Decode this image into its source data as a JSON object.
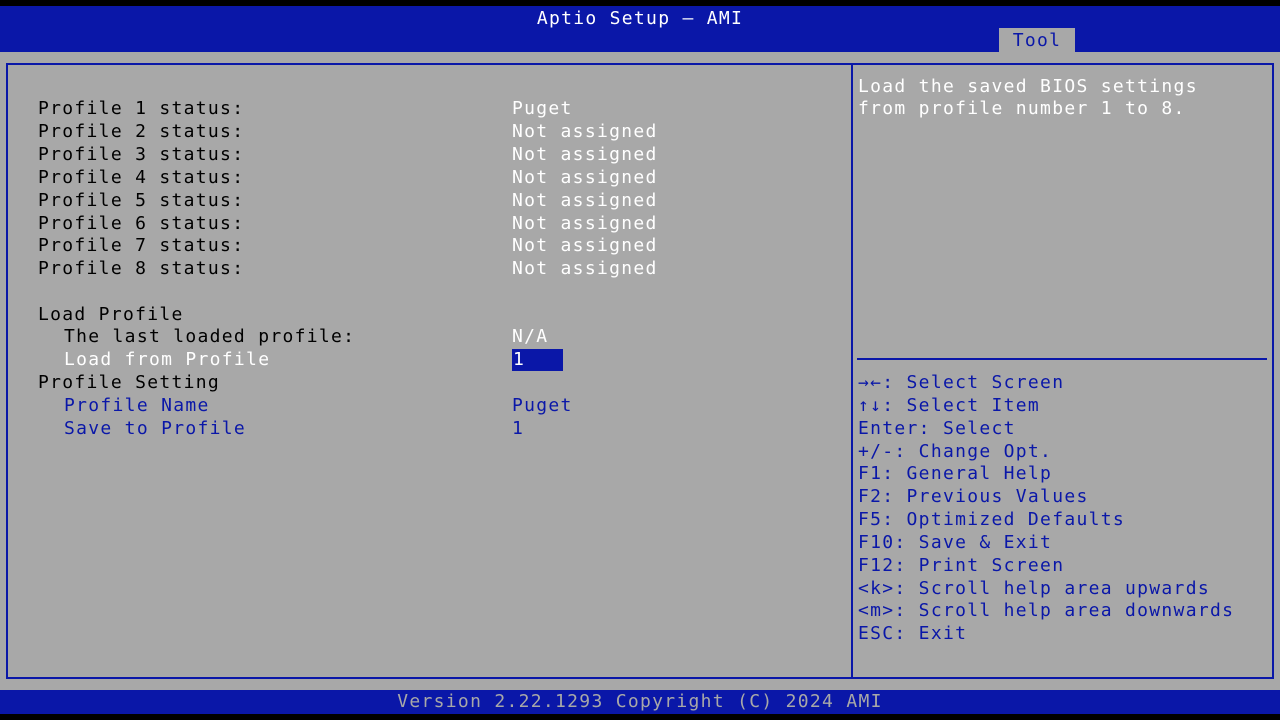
{
  "header": {
    "title": "Aptio Setup – AMI",
    "tab": "Tool"
  },
  "profiles": [
    {
      "label": "Profile 1 status:",
      "value": "Puget"
    },
    {
      "label": "Profile 2 status:",
      "value": "Not assigned"
    },
    {
      "label": "Profile 3 status:",
      "value": "Not assigned"
    },
    {
      "label": "Profile 4 status:",
      "value": "Not assigned"
    },
    {
      "label": "Profile 5 status:",
      "value": "Not assigned"
    },
    {
      "label": "Profile 6 status:",
      "value": "Not assigned"
    },
    {
      "label": "Profile 7 status:",
      "value": "Not assigned"
    },
    {
      "label": "Profile 8 status:",
      "value": "Not assigned"
    }
  ],
  "load_profile": {
    "heading": "Load Profile",
    "last_loaded_label": "The last loaded profile:",
    "last_loaded_value": "N/A",
    "load_from_label": "Load from Profile",
    "load_from_value": "1"
  },
  "profile_setting": {
    "heading": "Profile Setting",
    "name_label": "Profile Name",
    "name_value": "Puget",
    "save_label": "Save to Profile",
    "save_value": "1"
  },
  "help": {
    "lines": [
      "Load the saved BIOS settings",
      "from profile number 1 to 8."
    ]
  },
  "keys": [
    "→←: Select Screen",
    "↑↓: Select Item",
    "Enter: Select",
    "+/-: Change Opt.",
    "F1: General Help",
    "F2: Previous Values",
    "F5: Optimized Defaults",
    "F10: Save & Exit",
    "F12: Print Screen",
    "<k>: Scroll help area upwards",
    "<m>: Scroll help area downwards",
    "ESC: Exit"
  ],
  "footer": {
    "version": "Version 2.22.1293 Copyright (C) 2024 AMI"
  },
  "colors": {
    "bios_blue": "#0a17a8",
    "panel_gray": "#a8a8a8",
    "highlight_white": "#ffffff"
  }
}
